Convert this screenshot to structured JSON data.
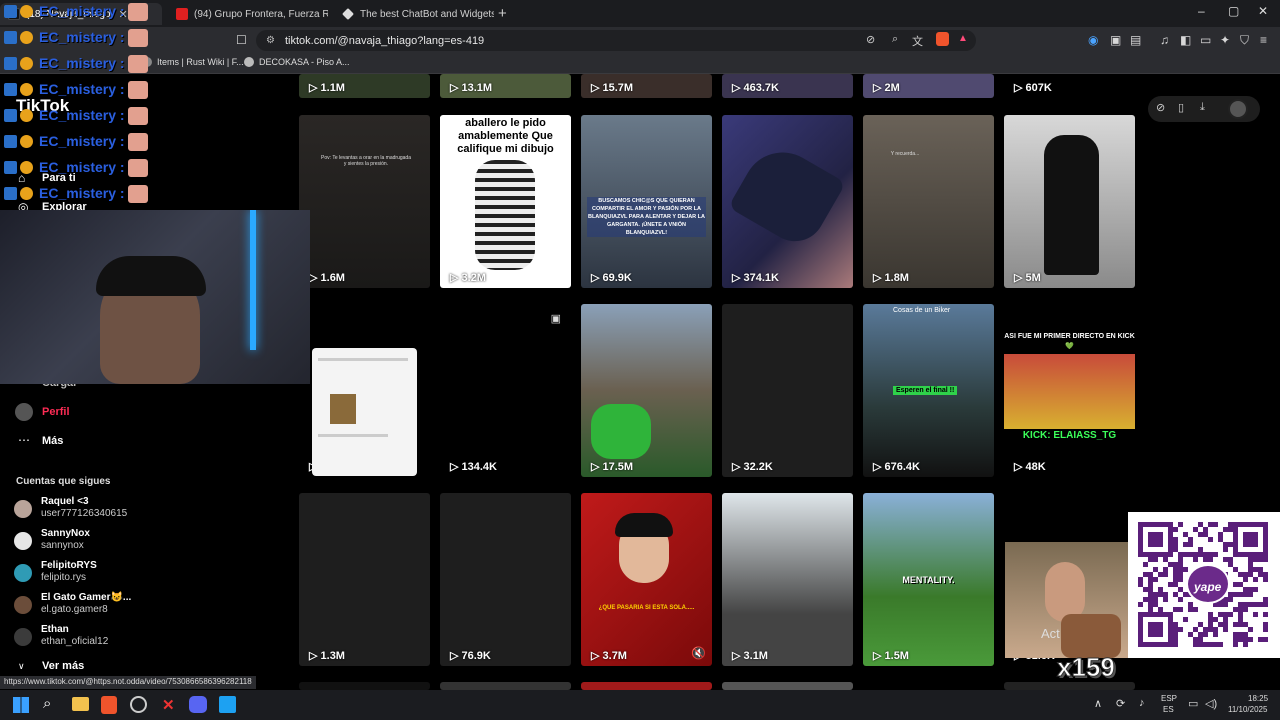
{
  "tabs": [
    {
      "label": "(18) Navaja_thiago",
      "active": true
    },
    {
      "label": "(94) Grupo Frontera, Fuerza Regida -",
      "active": false
    },
    {
      "label": "The best ChatBot and Widgets for Ki",
      "active": false
    }
  ],
  "window_controls": {
    "min": "–",
    "max": "▢",
    "close": "✕"
  },
  "address_bar": {
    "url": "tiktok.com/@navaja_thiago?lang=es-419"
  },
  "bookmarks": [
    "Items | Rust Wiki | F...",
    "DECOKASA - Piso A..."
  ],
  "tiktok": {
    "logo": "TikTok",
    "nav": {
      "for_you": "Para ti",
      "explore": "Explorar",
      "upload": "Cargar",
      "profile": "Perfil",
      "more": "Más"
    },
    "following_title": "Cuentas que sigues",
    "following": [
      {
        "name": "Raquel <3",
        "handle": "user777126340615",
        "color": "#b9a49a"
      },
      {
        "name": "SannyNox",
        "handle": "sannynox",
        "color": "#e6e6e6"
      },
      {
        "name": "FelipitoRYS",
        "handle": "felipito.rys",
        "color": "#2f9bb5"
      },
      {
        "name": "El Gato Gamer😺...",
        "handle": "el.gato.gamer8",
        "color": "#6b4d3a"
      },
      {
        "name": "Ethan",
        "handle": "ethan_oficial12",
        "color": "#3b3b3b"
      }
    ],
    "see_more": "Ver más"
  },
  "grid": {
    "top_row_views": [
      "1.1M",
      "13.1M",
      "15.7M",
      "463.7K",
      "2M",
      "607K"
    ],
    "row2": [
      {
        "views": "1.6M",
        "caption": "Pov: Te levantas a orar en la madrugada y sientes la presión."
      },
      {
        "views": "3.2M",
        "caption": "aballero le pido amablemente Que califique mi dibujo"
      },
      {
        "views": "69.9K",
        "caption": "BUSCAMOS CHIC@S QUE QUIERAN COMPARTIR EL AMOR Y PASIÓN POR LA BLANQUIAZVL PARA ALENTAR Y DEJAR LA GARGANTA. ¡ÚNETE A VNIÓN BLANQUIAZVL!"
      },
      {
        "views": "374.1K",
        "caption": ""
      },
      {
        "views": "1.8M",
        "caption": "Y recuerda..."
      },
      {
        "views": "5M",
        "caption": ""
      }
    ],
    "row3": [
      {
        "views": "510.1K",
        "caption": ""
      },
      {
        "views": "134.4K",
        "caption": ""
      },
      {
        "views": "17.5M",
        "caption": ""
      },
      {
        "views": "32.2K",
        "caption": ""
      },
      {
        "views": "676.4K",
        "caption": "Cosas de un Biker",
        "caption2": "Esperen el final !!"
      },
      {
        "views": "48K",
        "caption": "ASI FUE MI PRIMER DIRECTO EN KICK💚",
        "caption2": "KICK: ELAIASS_TG"
      }
    ],
    "row4": [
      {
        "views": "1.3M",
        "caption": ""
      },
      {
        "views": "76.9K",
        "caption": ""
      },
      {
        "views": "3.7M",
        "caption": "¿QUE PASARIA SI ESTA SOLA....."
      },
      {
        "views": "3.1M",
        "caption": ""
      },
      {
        "views": "1.5M",
        "caption": "MENTALITY."
      },
      {
        "views": "81.6K",
        "caption": ""
      }
    ]
  },
  "overlays": {
    "chat_name": "EC_mistery :",
    "chat_count": 8,
    "multiplier": "x159",
    "qr_label": "yape",
    "activate_text": "Act"
  },
  "status_url": "https://www.tiktok.com/@https.not.odda/video/7530866586396282118",
  "taskbar": {
    "lang": "ESP",
    "lang2": "ES",
    "time": "18:25",
    "date": "11/10/2025"
  }
}
